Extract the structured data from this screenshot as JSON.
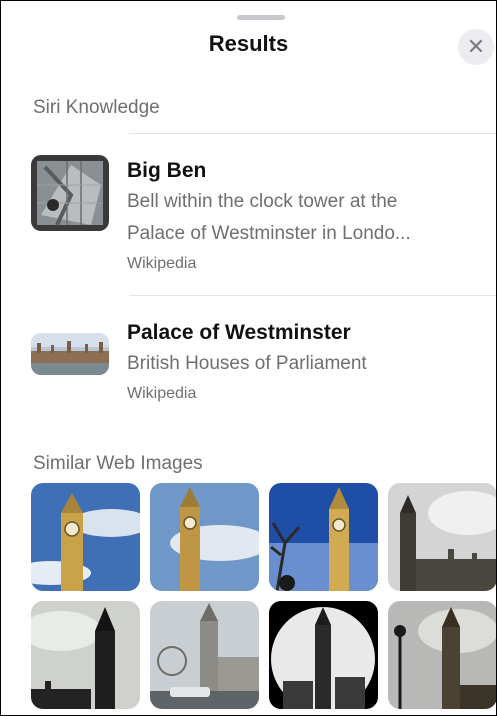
{
  "header": {
    "title": "Results",
    "close_icon": "close-icon"
  },
  "sections": {
    "siri_knowledge": "Siri Knowledge",
    "similar_web_images": "Similar Web Images"
  },
  "results": [
    {
      "title": "Big Ben",
      "subtitle_line1": "Bell within the clock tower at the",
      "subtitle_line2": "Palace of Westminster in Londo...",
      "source": "Wikipedia"
    },
    {
      "title": "Palace of Westminster",
      "subtitle_line1": "British Houses of Parliament",
      "source": "Wikipedia"
    }
  ],
  "colors": {
    "accent_gray": "#6e6e73",
    "divider": "#e3e3e6",
    "sky_blue": "#4f7fc4",
    "tower_gold": "#c9a24a"
  }
}
